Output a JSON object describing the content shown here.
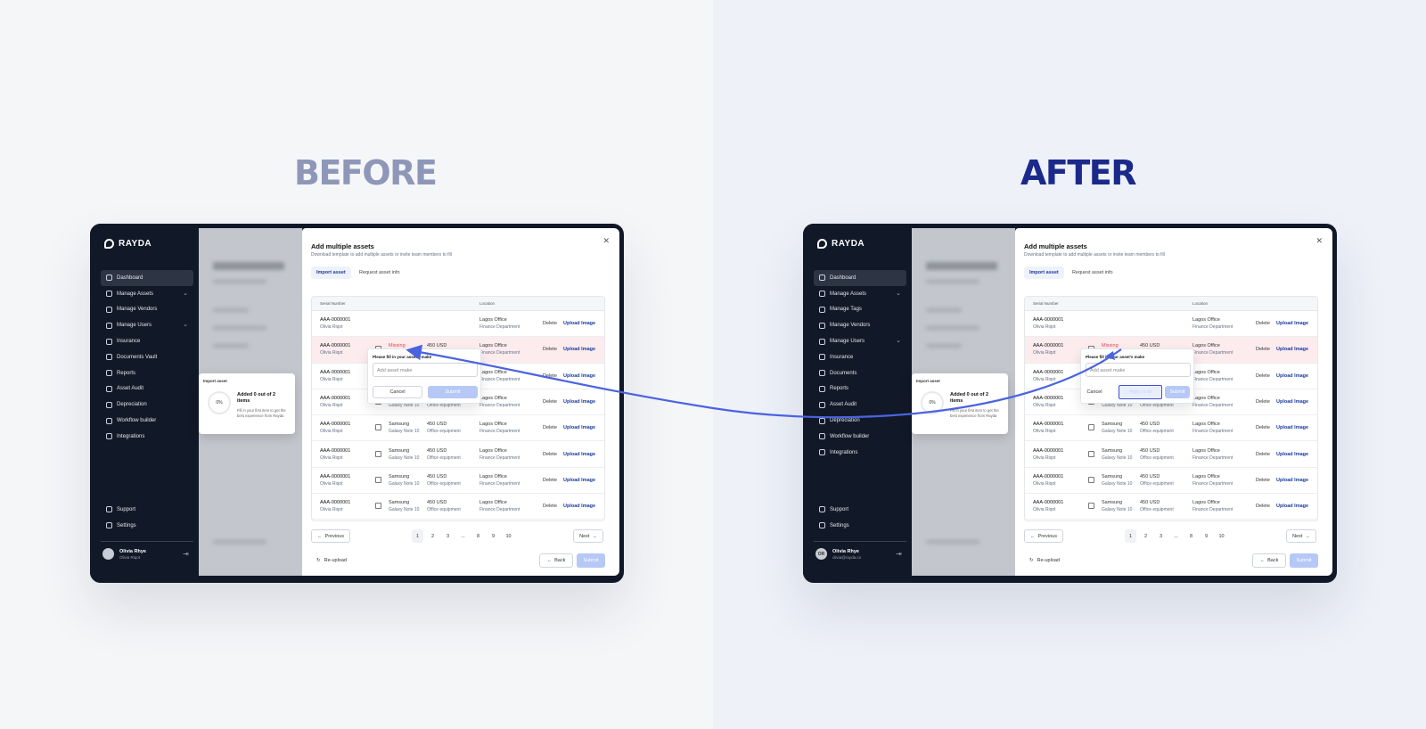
{
  "labels": {
    "before": "BEFORE",
    "after": "AFTER"
  },
  "colors": {
    "accent": "#1b3a9e",
    "arrow": "#4a63e0",
    "missing": "#e5484d",
    "sidebar": "#111827"
  },
  "left": {
    "sidebar": {
      "brand": "RAYDA",
      "items": [
        {
          "label": "Dashboard",
          "icon": "dashboard-icon",
          "chevron": ""
        },
        {
          "label": "Manage Assets",
          "icon": "box-icon",
          "chevron": "⌄"
        },
        {
          "label": "Manage Vendors",
          "icon": "vendor-icon",
          "chevron": ""
        },
        {
          "label": "Manage Users",
          "icon": "users-icon",
          "chevron": "⌄"
        },
        {
          "label": "Insurance",
          "icon": "shield-icon",
          "chevron": ""
        },
        {
          "label": "Documents Vault",
          "icon": "document-icon",
          "chevron": ""
        },
        {
          "label": "Reports",
          "icon": "report-icon",
          "chevron": ""
        },
        {
          "label": "Asset Audit",
          "icon": "audit-icon",
          "chevron": ""
        },
        {
          "label": "Depreciation",
          "icon": "depreciation-icon",
          "chevron": ""
        },
        {
          "label": "Workflow builder",
          "icon": "workflow-icon",
          "chevron": ""
        },
        {
          "label": "Integrations",
          "icon": "integrations-icon",
          "chevron": ""
        }
      ],
      "bottom": [
        {
          "label": "Support"
        },
        {
          "label": "Settings"
        }
      ],
      "user": {
        "name": "Olivia Rhye",
        "sub": "Olivia Riqot",
        "initials": ""
      }
    },
    "popover": {
      "label": "Please fill in your asset's make",
      "placeholder": "Add asset make",
      "cancel": "Cancel",
      "submit": "Submit",
      "apply": ""
    }
  },
  "right": {
    "sidebar": {
      "brand": "RAYDA",
      "items": [
        {
          "label": "Dashboard",
          "icon": "dashboard-icon",
          "chevron": ""
        },
        {
          "label": "Manage Assets",
          "icon": "box-icon",
          "chevron": "⌄"
        },
        {
          "label": "Manage Tags",
          "icon": "tag-icon",
          "chevron": ""
        },
        {
          "label": "Manage Vendors",
          "icon": "vendor-icon",
          "chevron": ""
        },
        {
          "label": "Manage Users",
          "icon": "users-icon",
          "chevron": "⌄"
        },
        {
          "label": "Insurance",
          "icon": "shield-icon",
          "chevron": ""
        },
        {
          "label": "Documents",
          "icon": "document-icon",
          "chevron": ""
        },
        {
          "label": "Reports",
          "icon": "report-icon",
          "chevron": ""
        },
        {
          "label": "Asset Audit",
          "icon": "audit-icon",
          "chevron": ""
        },
        {
          "label": "Depreciation",
          "icon": "depreciation-icon",
          "chevron": ""
        },
        {
          "label": "Workflow builder",
          "icon": "workflow-icon",
          "chevron": ""
        },
        {
          "label": "Integrations",
          "icon": "integrations-icon",
          "chevron": ""
        }
      ],
      "bottom": [
        {
          "label": "Support"
        },
        {
          "label": "Settings"
        }
      ],
      "user": {
        "name": "Olivia Rhye",
        "sub": "olivia@rayda.co",
        "initials": "OR"
      }
    },
    "popover": {
      "label": "Please fill in your asset's make",
      "placeholder": "Add asset make",
      "cancel": "Cancel",
      "submit": "Submit",
      "apply": "Apply to all"
    }
  },
  "modal": {
    "title": "Add multiple assets",
    "subtitle": "Download template to add multiple assets or invite team members to fill",
    "tabs": [
      "Import asset",
      "Request asset info"
    ],
    "columns": [
      "Serial Number",
      "Location"
    ],
    "rows": [
      {
        "serial": "AAA-0000001",
        "owner": "Olivia Riqot",
        "make": "",
        "model": "",
        "price": "",
        "category": "",
        "location": "Lagos Office",
        "dept": "Finance Department",
        "missing": false,
        "hidden": true
      },
      {
        "serial": "AAA-0000001",
        "owner": "Olivia Riqot",
        "make": "Missing",
        "model": "Galaxy Note 10",
        "price": "450 USD",
        "category": "Office equipment",
        "location": "Lagos Office",
        "dept": "Finance Department",
        "missing": true,
        "hidden": false
      },
      {
        "serial": "AAA-0000001",
        "owner": "Olivia Riqot",
        "make": "Samsung",
        "model": "Galaxy Note 10",
        "price": "450 USD",
        "category": "Office equipment",
        "location": "Lagos Office",
        "dept": "Finance Department",
        "missing": false,
        "hidden": false
      },
      {
        "serial": "AAA-0000001",
        "owner": "Olivia Riqot",
        "make": "Samsung",
        "model": "Galaxy Note 10",
        "price": "450 USD",
        "category": "Office equipment",
        "location": "Lagos Office",
        "dept": "Finance Department",
        "missing": false,
        "hidden": false
      },
      {
        "serial": "AAA-0000001",
        "owner": "Olivia Riqot",
        "make": "Samsung",
        "model": "Galaxy Note 10",
        "price": "450 USD",
        "category": "Office equipment",
        "location": "Lagos Office",
        "dept": "Finance Department",
        "missing": false,
        "hidden": false
      },
      {
        "serial": "AAA-0000001",
        "owner": "Olivia Riqot",
        "make": "Samsung",
        "model": "Galaxy Note 10",
        "price": "450 USD",
        "category": "Office equipment",
        "location": "Lagos Office",
        "dept": "Finance Department",
        "missing": false,
        "hidden": false
      },
      {
        "serial": "AAA-0000001",
        "owner": "Olivia Riqot",
        "make": "Samsung",
        "model": "Galaxy Note 10",
        "price": "450 USD",
        "category": "Office equipment",
        "location": "Lagos Office",
        "dept": "Finance Department",
        "missing": false,
        "hidden": false
      },
      {
        "serial": "AAA-0000001",
        "owner": "Olivia Riqot",
        "make": "Samsung",
        "model": "Galaxy Note 10",
        "price": "450 USD",
        "category": "Office equipment",
        "location": "Lagos Office",
        "dept": "Finance Department",
        "missing": false,
        "hidden": false
      }
    ],
    "row_actions": {
      "delete": "Delete",
      "upload": "Upload Image"
    },
    "pagination": {
      "previous": "Previous",
      "next": "Next",
      "pages": [
        "1",
        "2",
        "3",
        "...",
        "8",
        "9",
        "10"
      ],
      "current": "1"
    },
    "reupload": "Re-upload",
    "back": "Back",
    "submit": "Submit"
  },
  "import_card": {
    "title": "Import asset",
    "progress": "0%",
    "headline": "Added 0 out of 2 items",
    "body": "Fill in your first item to get the best experience from Rayda"
  }
}
